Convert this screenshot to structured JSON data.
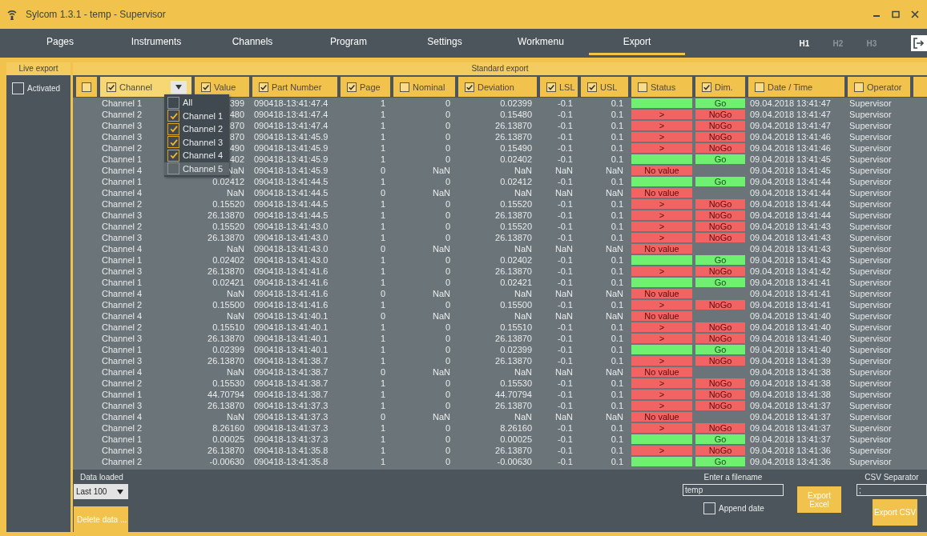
{
  "window": {
    "title": "Sylcom 1.3.1 - temp - Supervisor"
  },
  "nav": {
    "tabs": [
      {
        "label": "Pages",
        "selected": false
      },
      {
        "label": "Instruments",
        "selected": false
      },
      {
        "label": "Channels",
        "selected": false
      },
      {
        "label": "Program",
        "selected": false
      },
      {
        "label": "Settings",
        "selected": false
      },
      {
        "label": "Workmenu",
        "selected": false
      },
      {
        "label": "Export",
        "selected": true
      }
    ],
    "heads": [
      {
        "label": "H1",
        "selected": true
      },
      {
        "label": "H2",
        "selected": false
      },
      {
        "label": "H3",
        "selected": false
      }
    ]
  },
  "live_export": {
    "title": "Live export",
    "activated": {
      "label": "Activated",
      "checked": false
    }
  },
  "standard_export": {
    "title": "Standard export",
    "select_all": {
      "checked": false
    },
    "columns": [
      {
        "label": "Channel",
        "checked": true,
        "kind": "filter",
        "filter_open": true,
        "options": [
          {
            "label": "All",
            "checked": false,
            "highlighted": false
          },
          {
            "label": "Channel 1",
            "checked": true,
            "highlighted": false
          },
          {
            "label": "Channel 2",
            "checked": true,
            "highlighted": false
          },
          {
            "label": "Channel 3",
            "checked": true,
            "highlighted": false
          },
          {
            "label": "Channel 4",
            "checked": true,
            "highlighted": false
          },
          {
            "label": "Channel 5",
            "checked": false,
            "highlighted": true
          }
        ]
      },
      {
        "label": "Value",
        "checked": true,
        "kind": "plain"
      },
      {
        "label": "Part Number",
        "checked": true,
        "kind": "plain"
      },
      {
        "label": "Page",
        "checked": true,
        "kind": "plain"
      },
      {
        "label": "Nominal",
        "checked": false,
        "kind": "plain"
      },
      {
        "label": "Deviation",
        "checked": true,
        "kind": "plain"
      },
      {
        "label": "LSL",
        "checked": true,
        "kind": "plain"
      },
      {
        "label": "USL",
        "checked": true,
        "kind": "plain"
      },
      {
        "label": "Status",
        "checked": false,
        "kind": "plain"
      },
      {
        "label": "Dim.",
        "checked": true,
        "kind": "plain"
      },
      {
        "label": "Date / Time",
        "checked": false,
        "kind": "plain"
      },
      {
        "label": "Operator",
        "checked": false,
        "kind": "plain"
      }
    ],
    "rows": [
      {
        "channel": "Channel 1",
        "value": "399",
        "part_number": "090418-13:41:47.4",
        "page": "1",
        "nominal": "0",
        "deviation": "0.02399",
        "lsl": "-0.1",
        "usl": "0.1",
        "status": {
          "kind": "pass"
        },
        "dim": {
          "kind": "pass",
          "text": "Go"
        },
        "date_time": "09.04.2018 13:41:47",
        "operator": "Supervisor"
      },
      {
        "channel": "Channel 2",
        "value": "480",
        "part_number": "090418-13:41:47.4",
        "page": "1",
        "nominal": "0",
        "deviation": "0.15480",
        "lsl": "-0.1",
        "usl": "0.1",
        "status": {
          "kind": "fail",
          "text": ">"
        },
        "dim": {
          "kind": "fail",
          "text": "NoGo"
        },
        "date_time": "09.04.2018 13:41:47",
        "operator": "Supervisor"
      },
      {
        "channel": "Channel 3",
        "value": "870",
        "part_number": "090418-13:41:47.4",
        "page": "1",
        "nominal": "0",
        "deviation": "26.13870",
        "lsl": "-0.1",
        "usl": "0.1",
        "status": {
          "kind": "fail",
          "text": ">"
        },
        "dim": {
          "kind": "fail",
          "text": "NoGo"
        },
        "date_time": "09.04.2018 13:41:47",
        "operator": "Supervisor"
      },
      {
        "channel": "Channel 3",
        "value": "870",
        "part_number": "090418-13:41:45.9",
        "page": "1",
        "nominal": "0",
        "deviation": "26.13870",
        "lsl": "-0.1",
        "usl": "0.1",
        "status": {
          "kind": "fail",
          "text": ">"
        },
        "dim": {
          "kind": "fail",
          "text": "NoGo"
        },
        "date_time": "09.04.2018 13:41:46",
        "operator": "Supervisor"
      },
      {
        "channel": "Channel 2",
        "value": "490",
        "part_number": "090418-13:41:45.9",
        "page": "1",
        "nominal": "0",
        "deviation": "0.15490",
        "lsl": "-0.1",
        "usl": "0.1",
        "status": {
          "kind": "fail",
          "text": ">"
        },
        "dim": {
          "kind": "fail",
          "text": "NoGo"
        },
        "date_time": "09.04.2018 13:41:46",
        "operator": "Supervisor"
      },
      {
        "channel": "Channel 1",
        "value": "402",
        "part_number": "090418-13:41:45.9",
        "page": "1",
        "nominal": "0",
        "deviation": "0.02402",
        "lsl": "-0.1",
        "usl": "0.1",
        "status": {
          "kind": "pass"
        },
        "dim": {
          "kind": "pass",
          "text": "Go"
        },
        "date_time": "09.04.2018 13:41:45",
        "operator": "Supervisor"
      },
      {
        "channel": "Channel 4",
        "value": "NaN",
        "part_number": "090418-13:41:45.9",
        "page": "0",
        "nominal": "NaN",
        "deviation": "NaN",
        "lsl": "NaN",
        "usl": "NaN",
        "status": {
          "kind": "fail",
          "text": "No value"
        },
        "date_time": "09.04.2018 13:41:45",
        "operator": "Supervisor"
      },
      {
        "channel": "Channel 1",
        "value": "0.02412",
        "part_number": "090418-13:41:44.5",
        "page": "1",
        "nominal": "0",
        "deviation": "0.02412",
        "lsl": "-0.1",
        "usl": "0.1",
        "status": {
          "kind": "pass"
        },
        "dim": {
          "kind": "pass",
          "text": "Go"
        },
        "date_time": "09.04.2018 13:41:44",
        "operator": "Supervisor"
      },
      {
        "channel": "Channel 4",
        "value": "NaN",
        "part_number": "090418-13:41:44.5",
        "page": "0",
        "nominal": "NaN",
        "deviation": "NaN",
        "lsl": "NaN",
        "usl": "NaN",
        "status": {
          "kind": "fail",
          "text": "No value"
        },
        "date_time": "09.04.2018 13:41:44",
        "operator": "Supervisor"
      },
      {
        "channel": "Channel 2",
        "value": "0.15520",
        "part_number": "090418-13:41:44.5",
        "page": "1",
        "nominal": "0",
        "deviation": "0.15520",
        "lsl": "-0.1",
        "usl": "0.1",
        "status": {
          "kind": "fail",
          "text": ">"
        },
        "dim": {
          "kind": "fail",
          "text": "NoGo"
        },
        "date_time": "09.04.2018 13:41:44",
        "operator": "Supervisor"
      },
      {
        "channel": "Channel 3",
        "value": "26.13870",
        "part_number": "090418-13:41:44.5",
        "page": "1",
        "nominal": "0",
        "deviation": "26.13870",
        "lsl": "-0.1",
        "usl": "0.1",
        "status": {
          "kind": "fail",
          "text": ">"
        },
        "dim": {
          "kind": "fail",
          "text": "NoGo"
        },
        "date_time": "09.04.2018 13:41:44",
        "operator": "Supervisor"
      },
      {
        "channel": "Channel 2",
        "value": "0.15520",
        "part_number": "090418-13:41:43.0",
        "page": "1",
        "nominal": "0",
        "deviation": "0.15520",
        "lsl": "-0.1",
        "usl": "0.1",
        "status": {
          "kind": "fail",
          "text": ">"
        },
        "dim": {
          "kind": "fail",
          "text": "NoGo"
        },
        "date_time": "09.04.2018 13:41:43",
        "operator": "Supervisor"
      },
      {
        "channel": "Channel 3",
        "value": "26.13870",
        "part_number": "090418-13:41:43.0",
        "page": "1",
        "nominal": "0",
        "deviation": "26.13870",
        "lsl": "-0.1",
        "usl": "0.1",
        "status": {
          "kind": "fail",
          "text": ">"
        },
        "dim": {
          "kind": "fail",
          "text": "NoGo"
        },
        "date_time": "09.04.2018 13:41:43",
        "operator": "Supervisor"
      },
      {
        "channel": "Channel 4",
        "value": "NaN",
        "part_number": "090418-13:41:43.0",
        "page": "0",
        "nominal": "NaN",
        "deviation": "NaN",
        "lsl": "NaN",
        "usl": "NaN",
        "status": {
          "kind": "fail",
          "text": "No value"
        },
        "date_time": "09.04.2018 13:41:43",
        "operator": "Supervisor"
      },
      {
        "channel": "Channel 1",
        "value": "0.02402",
        "part_number": "090418-13:41:43.0",
        "page": "1",
        "nominal": "0",
        "deviation": "0.02402",
        "lsl": "-0.1",
        "usl": "0.1",
        "status": {
          "kind": "pass"
        },
        "dim": {
          "kind": "pass",
          "text": "Go"
        },
        "date_time": "09.04.2018 13:41:43",
        "operator": "Supervisor"
      },
      {
        "channel": "Channel 3",
        "value": "26.13870",
        "part_number": "090418-13:41:41.6",
        "page": "1",
        "nominal": "0",
        "deviation": "26.13870",
        "lsl": "-0.1",
        "usl": "0.1",
        "status": {
          "kind": "fail",
          "text": ">"
        },
        "dim": {
          "kind": "fail",
          "text": "NoGo"
        },
        "date_time": "09.04.2018 13:41:42",
        "operator": "Supervisor"
      },
      {
        "channel": "Channel 1",
        "value": "0.02421",
        "part_number": "090418-13:41:41.6",
        "page": "1",
        "nominal": "0",
        "deviation": "0.02421",
        "lsl": "-0.1",
        "usl": "0.1",
        "status": {
          "kind": "pass"
        },
        "dim": {
          "kind": "pass",
          "text": "Go"
        },
        "date_time": "09.04.2018 13:41:41",
        "operator": "Supervisor"
      },
      {
        "channel": "Channel 4",
        "value": "NaN",
        "part_number": "090418-13:41:41.6",
        "page": "0",
        "nominal": "NaN",
        "deviation": "NaN",
        "lsl": "NaN",
        "usl": "NaN",
        "status": {
          "kind": "fail",
          "text": "No value"
        },
        "date_time": "09.04.2018 13:41:41",
        "operator": "Supervisor"
      },
      {
        "channel": "Channel 2",
        "value": "0.15500",
        "part_number": "090418-13:41:41.6",
        "page": "1",
        "nominal": "0",
        "deviation": "0.15500",
        "lsl": "-0.1",
        "usl": "0.1",
        "status": {
          "kind": "fail",
          "text": ">"
        },
        "dim": {
          "kind": "fail",
          "text": "NoGo"
        },
        "date_time": "09.04.2018 13:41:41",
        "operator": "Supervisor"
      },
      {
        "channel": "Channel 4",
        "value": "NaN",
        "part_number": "090418-13:41:40.1",
        "page": "0",
        "nominal": "NaN",
        "deviation": "NaN",
        "lsl": "NaN",
        "usl": "NaN",
        "status": {
          "kind": "fail",
          "text": "No value"
        },
        "date_time": "09.04.2018 13:41:40",
        "operator": "Supervisor"
      },
      {
        "channel": "Channel 2",
        "value": "0.15510",
        "part_number": "090418-13:41:40.1",
        "page": "1",
        "nominal": "0",
        "deviation": "0.15510",
        "lsl": "-0.1",
        "usl": "0.1",
        "status": {
          "kind": "fail",
          "text": ">"
        },
        "dim": {
          "kind": "fail",
          "text": "NoGo"
        },
        "date_time": "09.04.2018 13:41:40",
        "operator": "Supervisor"
      },
      {
        "channel": "Channel 3",
        "value": "26.13870",
        "part_number": "090418-13:41:40.1",
        "page": "1",
        "nominal": "0",
        "deviation": "26.13870",
        "lsl": "-0.1",
        "usl": "0.1",
        "status": {
          "kind": "fail",
          "text": ">"
        },
        "dim": {
          "kind": "fail",
          "text": "NoGo"
        },
        "date_time": "09.04.2018 13:41:40",
        "operator": "Supervisor"
      },
      {
        "channel": "Channel 1",
        "value": "0.02399",
        "part_number": "090418-13:41:40.1",
        "page": "1",
        "nominal": "0",
        "deviation": "0.02399",
        "lsl": "-0.1",
        "usl": "0.1",
        "status": {
          "kind": "pass"
        },
        "dim": {
          "kind": "pass",
          "text": "Go"
        },
        "date_time": "09.04.2018 13:41:40",
        "operator": "Supervisor"
      },
      {
        "channel": "Channel 3",
        "value": "26.13870",
        "part_number": "090418-13:41:38.7",
        "page": "1",
        "nominal": "0",
        "deviation": "26.13870",
        "lsl": "-0.1",
        "usl": "0.1",
        "status": {
          "kind": "fail",
          "text": ">"
        },
        "dim": {
          "kind": "fail",
          "text": "NoGo"
        },
        "date_time": "09.04.2018 13:41:39",
        "operator": "Supervisor"
      },
      {
        "channel": "Channel 4",
        "value": "NaN",
        "part_number": "090418-13:41:38.7",
        "page": "0",
        "nominal": "NaN",
        "deviation": "NaN",
        "lsl": "NaN",
        "usl": "NaN",
        "status": {
          "kind": "fail",
          "text": "No value"
        },
        "date_time": "09.04.2018 13:41:38",
        "operator": "Supervisor"
      },
      {
        "channel": "Channel 2",
        "value": "0.15530",
        "part_number": "090418-13:41:38.7",
        "page": "1",
        "nominal": "0",
        "deviation": "0.15530",
        "lsl": "-0.1",
        "usl": "0.1",
        "status": {
          "kind": "fail",
          "text": ">"
        },
        "dim": {
          "kind": "fail",
          "text": "NoGo"
        },
        "date_time": "09.04.2018 13:41:38",
        "operator": "Supervisor"
      },
      {
        "channel": "Channel 1",
        "value": "44.70794",
        "part_number": "090418-13:41:38.7",
        "page": "1",
        "nominal": "0",
        "deviation": "44.70794",
        "lsl": "-0.1",
        "usl": "0.1",
        "status": {
          "kind": "fail",
          "text": ">"
        },
        "dim": {
          "kind": "fail",
          "text": "NoGo"
        },
        "date_time": "09.04.2018 13:41:38",
        "operator": "Supervisor"
      },
      {
        "channel": "Channel 3",
        "value": "26.13870",
        "part_number": "090418-13:41:37.3",
        "page": "1",
        "nominal": "0",
        "deviation": "26.13870",
        "lsl": "-0.1",
        "usl": "0.1",
        "status": {
          "kind": "fail",
          "text": ">"
        },
        "dim": {
          "kind": "fail",
          "text": "NoGo"
        },
        "date_time": "09.04.2018 13:41:37",
        "operator": "Supervisor"
      },
      {
        "channel": "Channel 4",
        "value": "NaN",
        "part_number": "090418-13:41:37.3",
        "page": "0",
        "nominal": "NaN",
        "deviation": "NaN",
        "lsl": "NaN",
        "usl": "NaN",
        "status": {
          "kind": "fail",
          "text": "No value"
        },
        "date_time": "09.04.2018 13:41:37",
        "operator": "Supervisor"
      },
      {
        "channel": "Channel 2",
        "value": "8.26160",
        "part_number": "090418-13:41:37.3",
        "page": "1",
        "nominal": "0",
        "deviation": "8.26160",
        "lsl": "-0.1",
        "usl": "0.1",
        "status": {
          "kind": "fail",
          "text": ">"
        },
        "dim": {
          "kind": "fail",
          "text": "NoGo"
        },
        "date_time": "09.04.2018 13:41:37",
        "operator": "Supervisor"
      },
      {
        "channel": "Channel 1",
        "value": "0.00025",
        "part_number": "090418-13:41:37.3",
        "page": "1",
        "nominal": "0",
        "deviation": "0.00025",
        "lsl": "-0.1",
        "usl": "0.1",
        "status": {
          "kind": "pass"
        },
        "dim": {
          "kind": "pass",
          "text": "Go"
        },
        "date_time": "09.04.2018 13:41:37",
        "operator": "Supervisor"
      },
      {
        "channel": "Channel 3",
        "value": "26.13870",
        "part_number": "090418-13:41:35.8",
        "page": "1",
        "nominal": "0",
        "deviation": "26.13870",
        "lsl": "-0.1",
        "usl": "0.1",
        "status": {
          "kind": "fail",
          "text": ">"
        },
        "dim": {
          "kind": "fail",
          "text": "NoGo"
        },
        "date_time": "09.04.2018 13:41:36",
        "operator": "Supervisor"
      },
      {
        "channel": "Channel 2",
        "value": "-0.00630",
        "part_number": "090418-13:41:35.8",
        "page": "1",
        "nominal": "0",
        "deviation": "-0.00630",
        "lsl": "-0.1",
        "usl": "0.1",
        "status": {
          "kind": "pass"
        },
        "dim": {
          "kind": "pass",
          "text": "Go"
        },
        "date_time": "09.04.2018 13:41:36",
        "operator": "Supervisor"
      }
    ]
  },
  "footer": {
    "data_loaded": {
      "label": "Data loaded",
      "value": "Last 100"
    },
    "delete_button": "Delete data ...",
    "filename": {
      "label": "Enter a filename",
      "value": "temp"
    },
    "append_date": {
      "label": "Append date",
      "checked": false
    },
    "export_excel": "Export Excel",
    "csv_separator": {
      "label": "CSV Separator",
      "value": ";"
    },
    "export_csv": "Export CSV"
  }
}
